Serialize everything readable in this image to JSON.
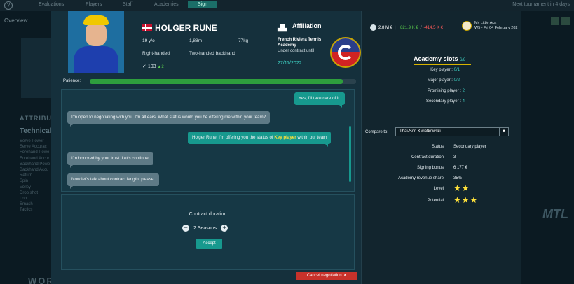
{
  "background": {
    "topbar_tabs": [
      "Evaluations",
      "Players",
      "Staff",
      "Academies",
      "Sign"
    ],
    "next_tournament": "Next tournament in 4 days",
    "overview_tab": "Overview",
    "attributes_heading": "ATTRIBUT",
    "technical_heading": "Technical",
    "attribute_list": [
      "Serve Power",
      "Serve Accurac",
      "Forehand Powe",
      "Forehand Accur",
      "Backhand Powe",
      "Backhand Accu",
      "Return",
      "Spin",
      "Volley",
      "Drop shot",
      "Lob",
      "Smash",
      "Tactics"
    ],
    "footer_text": "WORK IN",
    "mtl_text": "MTL"
  },
  "player": {
    "name": "HOLGER RUNE",
    "age": "19 y/o",
    "height": "1,88m",
    "weight": "77kg",
    "handedness": "Right-handed",
    "backhand": "Two-handed backhand",
    "rating": "103",
    "rating_delta": "2"
  },
  "affiliation": {
    "title": "Affiliation",
    "academy": "French Riviera Tennis Academy",
    "contract_text": "Under contract until",
    "contract_date": "27/11/2022"
  },
  "patience": {
    "label": "Patience:",
    "value": 0.95
  },
  "chat": {
    "messages": [
      {
        "from": "me",
        "text": "Yes, I'll take care of it."
      },
      {
        "from": "them",
        "text": "I'm open to negotiating with you. I'm all ears. What status would you be offering me within your team?"
      },
      {
        "from": "me",
        "text_before": "Holger Rune, I'm offering you the status of ",
        "highlight": "Key player",
        "text_after": " within our team"
      },
      {
        "from": "them",
        "text": "I'm honored by your trust. Let's continue."
      },
      {
        "from": "them",
        "text": "Now let's talk about contract length, please."
      }
    ]
  },
  "contract": {
    "title": "Contract duration",
    "value": "2 Seasons",
    "decrement_symbol": "−",
    "increment_symbol": "+",
    "accept_label": "Accept",
    "cancel_label": "Cancel negotiation",
    "cancel_symbol": "×"
  },
  "finance": {
    "balance": "2.8 M €",
    "separator1": "|",
    "income": "+821.9 K €",
    "separator2": "/",
    "expense": "-414.5 K €"
  },
  "club": {
    "name": "My Little Aca",
    "date": "W5 - Fri 04 February 202"
  },
  "academy_slots": {
    "title": "Academy slots",
    "count": "6/8",
    "rows": [
      {
        "label": "Key player :",
        "value": "0/1"
      },
      {
        "label": "Major player :",
        "value": "0/2"
      },
      {
        "label": "Promising player :",
        "value": "2"
      },
      {
        "label": "Secondary player :",
        "value": "4"
      }
    ]
  },
  "compare": {
    "label": "Compare to:",
    "selected": "Thai-Son Kwiatkowski",
    "arrow": "▼",
    "rows": [
      {
        "label": "Status",
        "value": "Secondary player"
      },
      {
        "label": "Contract duration",
        "value": "3"
      },
      {
        "label": "Signing bonus",
        "value": "6 177 €"
      },
      {
        "label": "Academy revenue share",
        "value": "35%"
      }
    ],
    "level_label": "Level",
    "level_stars": "★★",
    "potential_label": "Potential",
    "potential_stars": "★★★"
  },
  "colors": {
    "accent_teal": "#17998e",
    "patience_green": "#2e9e3d",
    "highlight_yellow": "#ffe23a",
    "cancel_red": "#c7322b"
  }
}
